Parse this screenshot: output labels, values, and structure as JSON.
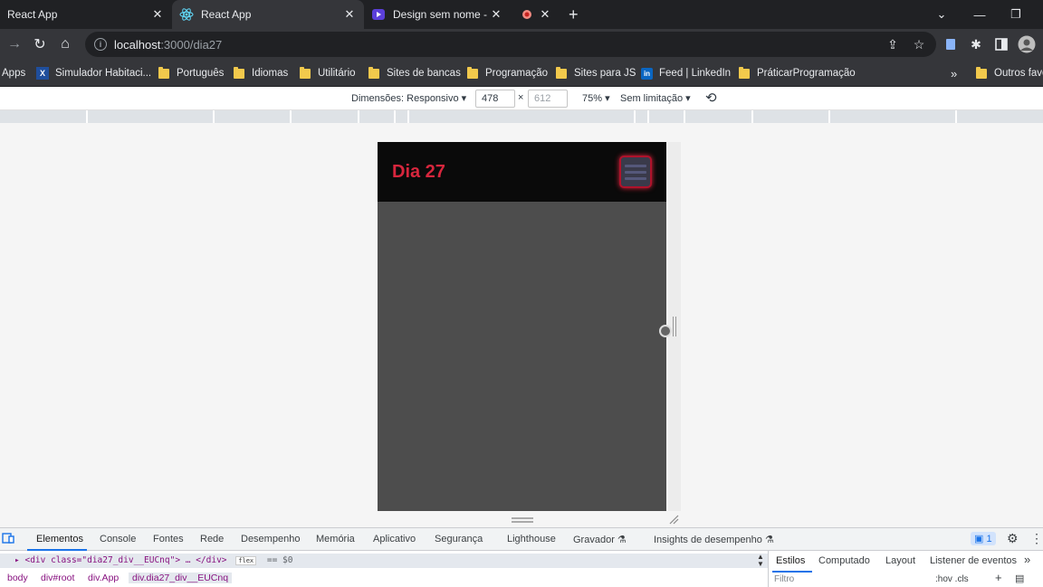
{
  "tabs": [
    {
      "title": "React App",
      "icon": "blank-icon",
      "active": false
    },
    {
      "title": "React App",
      "icon": "react-icon",
      "active": true
    },
    {
      "title": "Design sem nome - Vídeo",
      "icon": "canva-video-icon",
      "active": false
    },
    {
      "title": "",
      "icon": "recording-icon",
      "active": false
    }
  ],
  "toolbar": {
    "url_host": "localhost",
    "url_rest": ":3000/dia27"
  },
  "bookmarks": [
    {
      "label": "Apps"
    },
    {
      "label": "Simulador Habitaci..."
    },
    {
      "label": "Português"
    },
    {
      "label": "Idiomas"
    },
    {
      "label": "Utilitário"
    },
    {
      "label": "Sites de bancas"
    },
    {
      "label": "Programação"
    },
    {
      "label": "Sites para JS"
    },
    {
      "label": "Feed | LinkedIn"
    },
    {
      "label": "PráticarProgramação"
    },
    {
      "label": "Outros favo"
    }
  ],
  "device_toolbar": {
    "dimensions_label": "Dimensões: Responsivo",
    "width": "478",
    "times": "×",
    "height": "612",
    "zoom": "75%",
    "throttle": "Sem limitação"
  },
  "app": {
    "title": "Dia 27",
    "colors": {
      "header": "#0a0a0a",
      "body": "#4d4d4d",
      "accent": "#d7263d"
    }
  },
  "devtools": {
    "tabs": [
      "Elementos",
      "Console",
      "Fontes",
      "Rede",
      "Desempenho",
      "Memória",
      "Aplicativo",
      "Segurança",
      "Lighthouse",
      "Gravador",
      "Insights de desempenho"
    ],
    "issues_count": "1",
    "dom_line": "<div class=\"dia27_div__EUCnq\"> … </div>",
    "flex_badge": "flex",
    "selected_marker": "== $0",
    "breadcrumbs": [
      "body",
      "div#root",
      "div.App",
      "div.dia27_div__EUCnq"
    ],
    "styles_tabs": [
      "Estilos",
      "Computado",
      "Layout",
      "Listener de eventos"
    ],
    "filter_placeholder": "Filtro",
    "hov_cls": ":hov  .cls"
  }
}
